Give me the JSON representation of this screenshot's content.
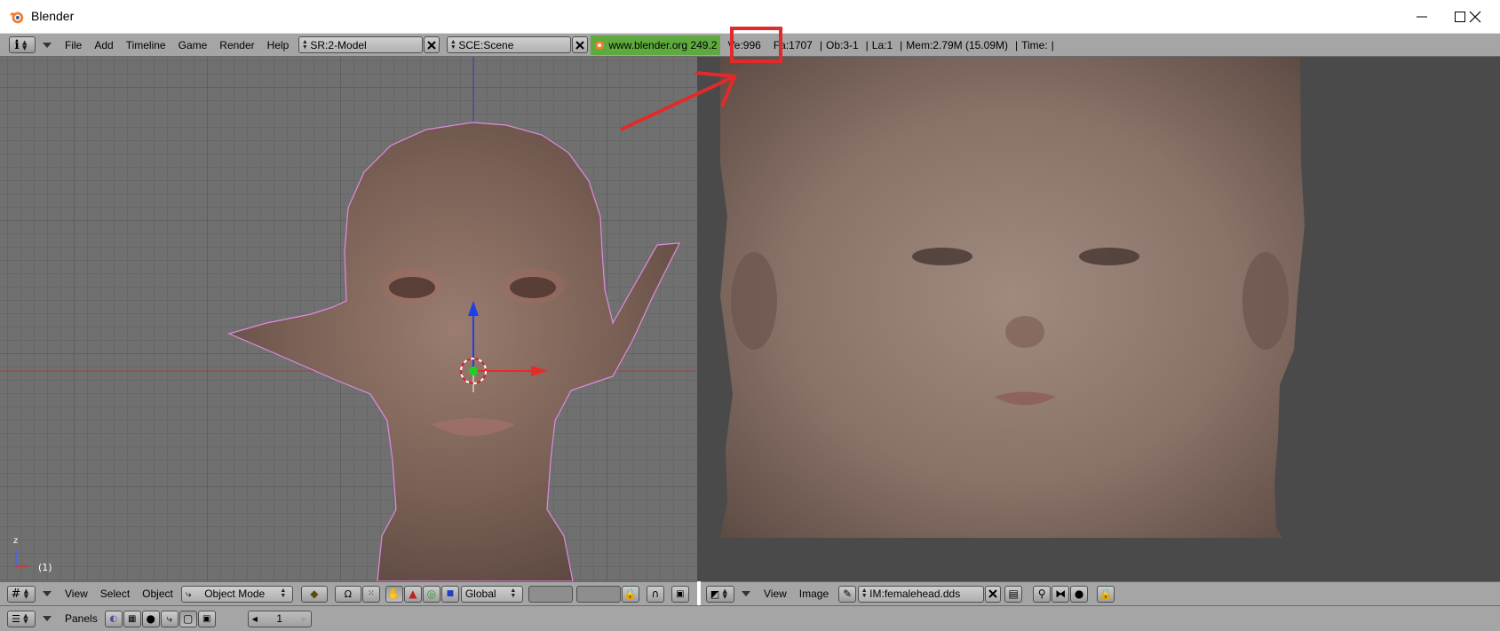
{
  "window": {
    "title": "Blender"
  },
  "infobar": {
    "menus": [
      "File",
      "Add",
      "Timeline",
      "Game",
      "Render",
      "Help"
    ],
    "screen_field": "SR:2-Model",
    "scene_field": "SCE:Scene",
    "version_text": "www.blender.org 249.2",
    "stats": {
      "vertices": "Ve:996",
      "faces": "Fa:1707",
      "objects": "Ob:3-1",
      "lamps": "La:1",
      "memory": "Mem:2.79M (15.09M)",
      "time": "Time:"
    }
  },
  "view3d": {
    "frame_label": "(1)",
    "axis_label": "z",
    "header": {
      "menus": [
        "View",
        "Select",
        "Object"
      ],
      "mode": "Object Mode",
      "orientation": "Global"
    }
  },
  "image_editor": {
    "header": {
      "menus": [
        "View",
        "Image"
      ],
      "image_name": "IM:femalehead.dds"
    }
  },
  "buttons_window": {
    "label": "Panels",
    "frame": "1"
  },
  "colors": {
    "highlight_box": "#e32a2a",
    "www_bg": "#5faa3f",
    "header_gray": "#a5a5a5"
  }
}
